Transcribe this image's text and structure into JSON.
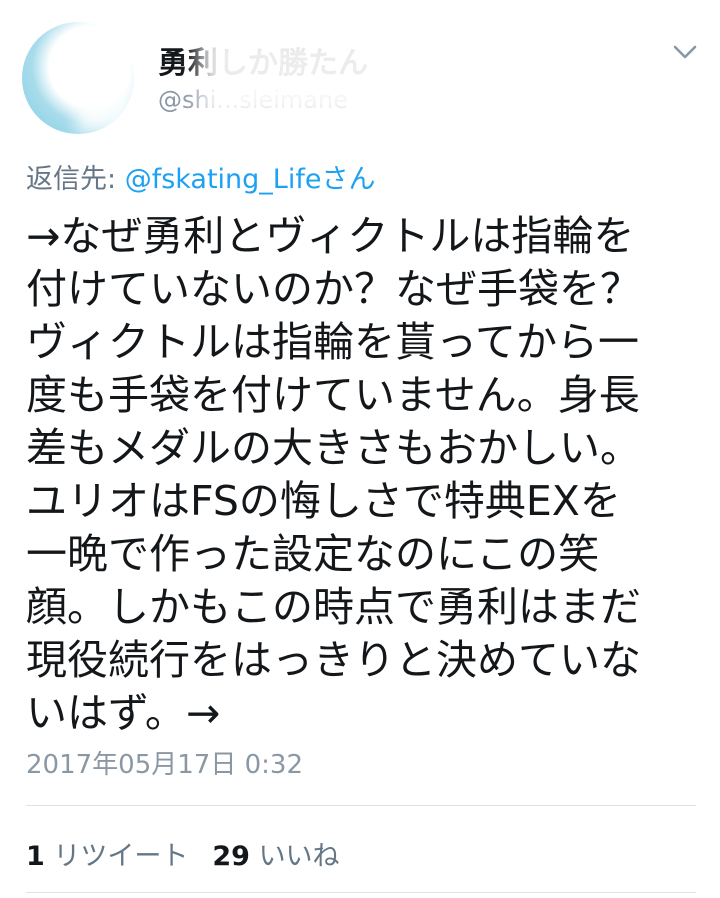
{
  "header": {
    "display_name": "勇利しか勝たん",
    "handle": "@shi...sleimane",
    "menu_icon": "chevron-down-icon"
  },
  "reply": {
    "prefix": "返信先: ",
    "mention": "@fskating_Lifeさん"
  },
  "tweet": {
    "lines": [
      "→なぜ勇利とヴィクトルは指輪を",
      "付けていないのか？なぜ手袋を？",
      "ヴィクトルは指輪を貰ってから一",
      "度も手袋を付けていません。身長",
      "差もメダルの大きさもおかしい。",
      "ユリオはFSの悔しさで特典EXを",
      "一晩で作った設定なのにこの笑",
      "顔。しかもこの時点で勇利はまだ",
      "現役続行をはっきりと決めていな",
      "いはず。→"
    ],
    "timestamp": "2017年05月17日 0:32"
  },
  "stats": {
    "retweets_count": "1",
    "retweets_label": "リツイート",
    "likes_count": "29",
    "likes_label": "いいね"
  },
  "colors": {
    "link": "#1da1f2",
    "muted": "#8a98a6",
    "text": "#14171a",
    "divider": "#dde3e8"
  }
}
